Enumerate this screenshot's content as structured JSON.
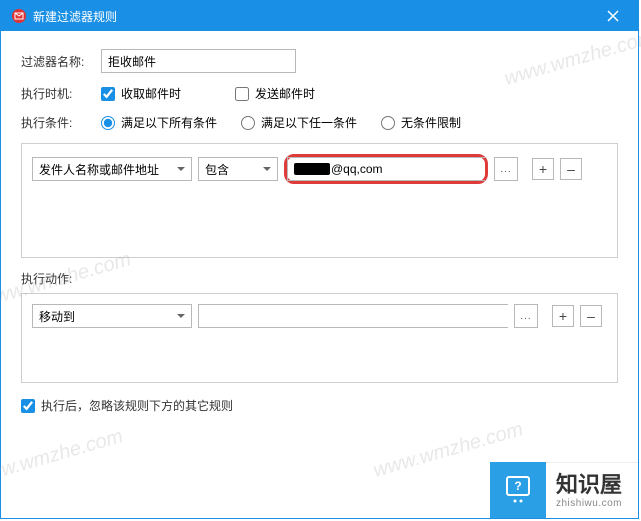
{
  "titlebar": {
    "title": "新建过滤器规则"
  },
  "form": {
    "name_label": "过滤器名称:",
    "name_value": "拒收邮件",
    "when_label": "执行时机:",
    "when_receive": "收取邮件时",
    "when_send": "发送邮件时",
    "cond_label": "执行条件:",
    "cond_all": "满足以下所有条件",
    "cond_any": "满足以下任一条件",
    "cond_none": "无条件限制"
  },
  "condition": {
    "field_sel": "发件人名称或邮件地址",
    "op_sel": "包含",
    "value": "@qq,com",
    "dots": "...",
    "add": "+",
    "remove": "–"
  },
  "action": {
    "section_label": "执行动作:",
    "op_sel": "移动到",
    "dots": "...",
    "add": "+",
    "remove": "–"
  },
  "ignore": {
    "label": "执行后，忽略该规则下方的其它规则"
  },
  "watermark": "www.wmzhe.com",
  "logo": {
    "ch": "知识屋",
    "en": "zhishiwu.com"
  }
}
